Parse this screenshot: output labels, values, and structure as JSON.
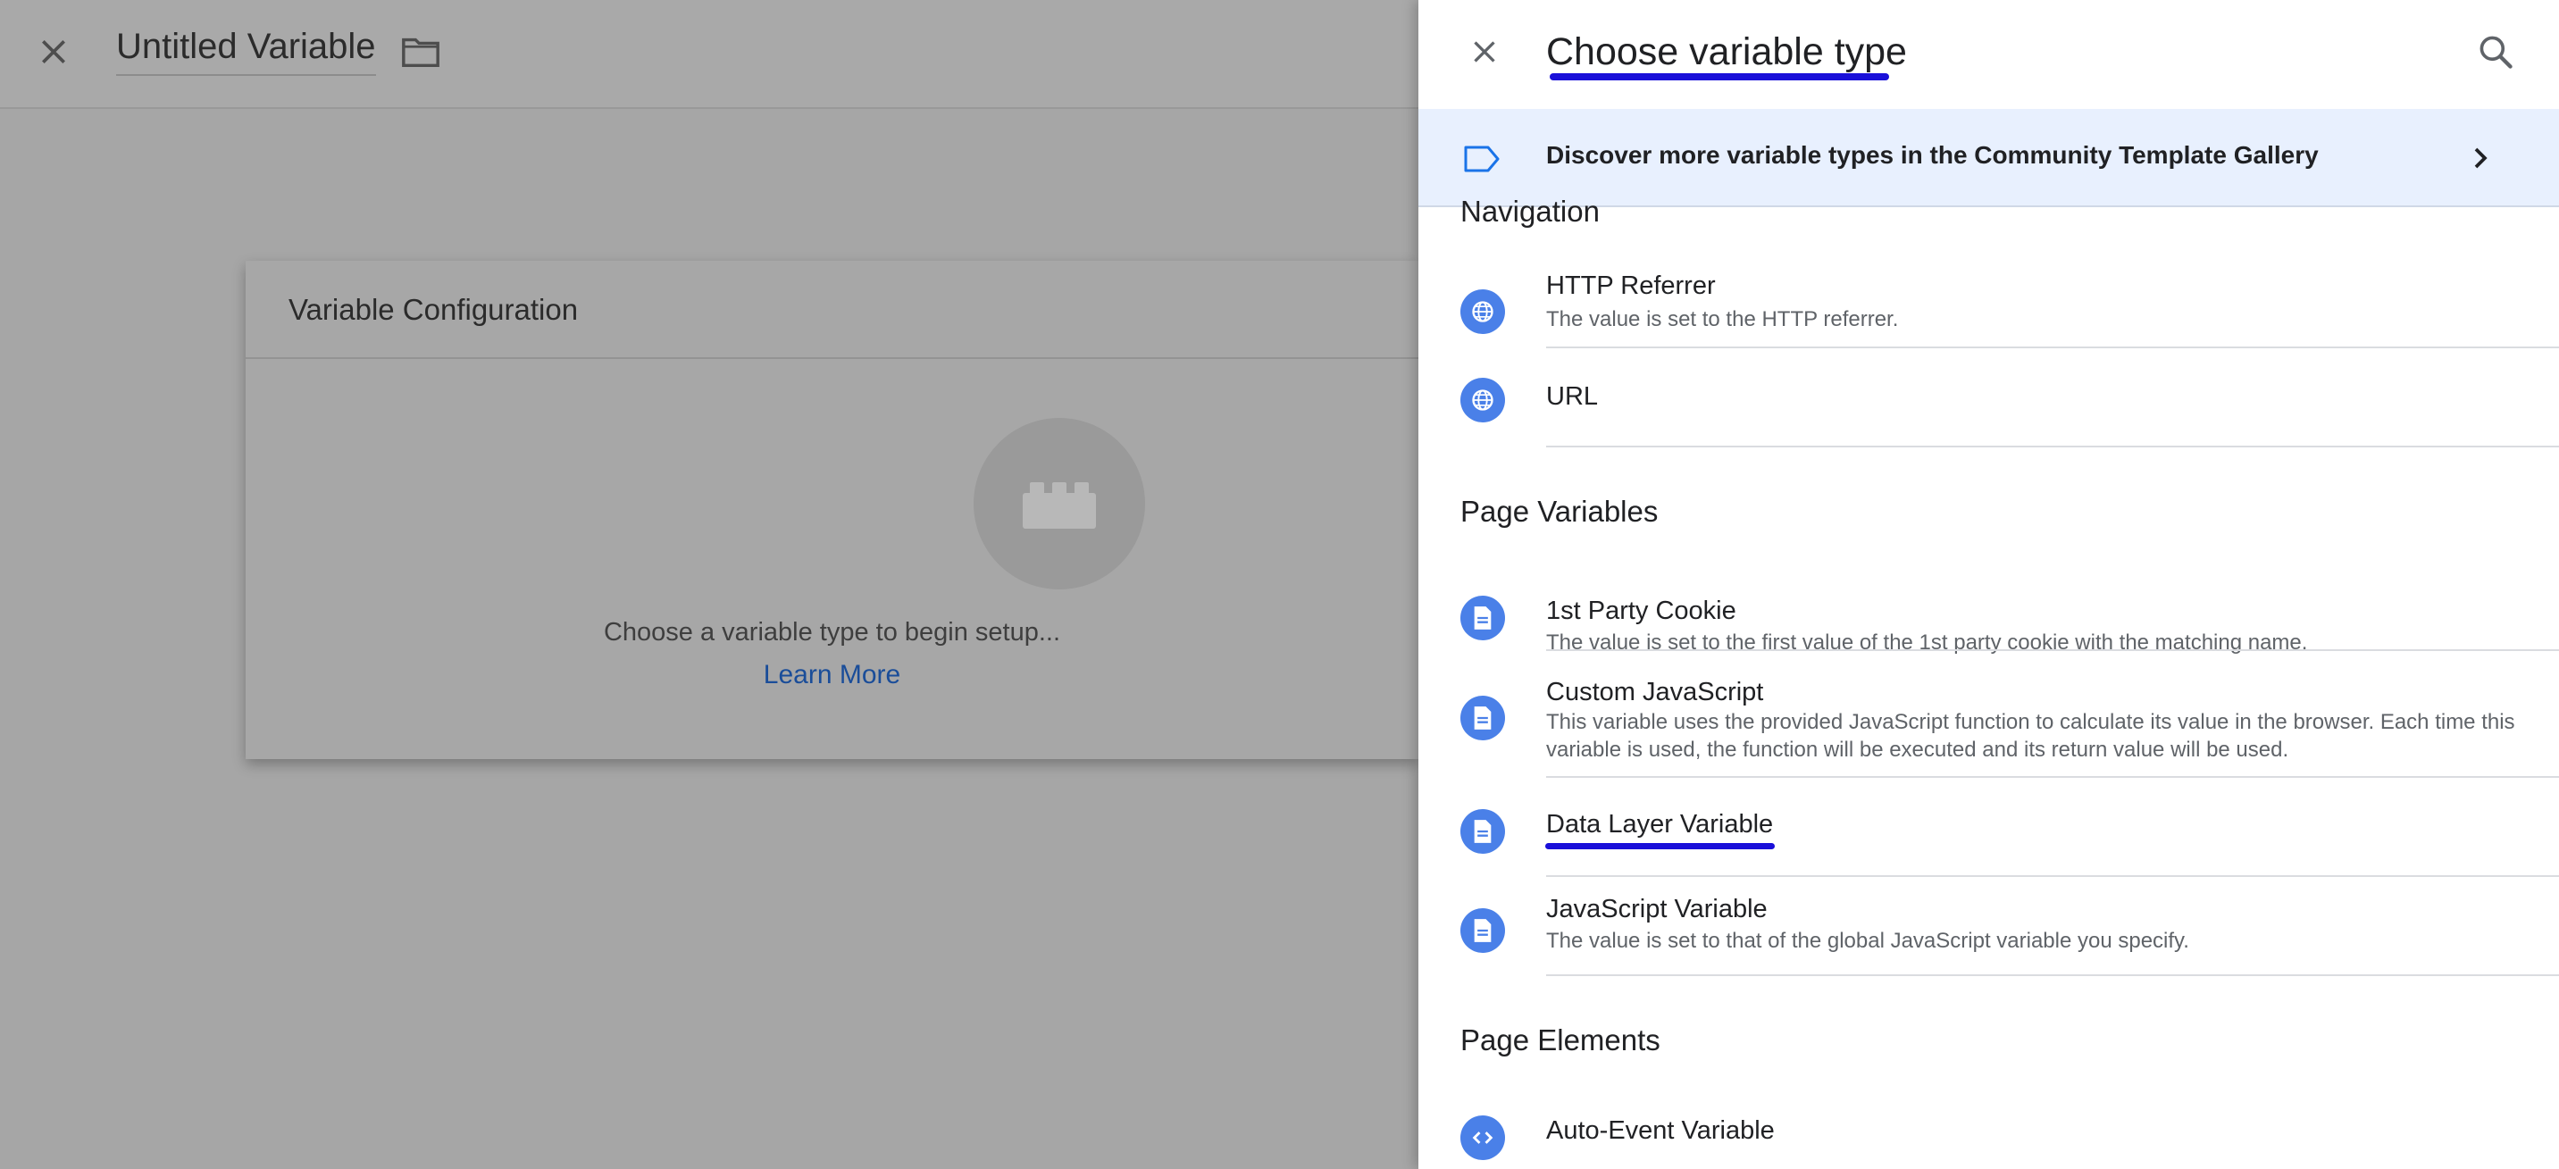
{
  "editor": {
    "title": "Untitled Variable",
    "card_title": "Variable Configuration",
    "placeholder_text": "Choose a variable type to begin setup...",
    "learn_more": "Learn More"
  },
  "drawer": {
    "title": "Choose variable type",
    "banner_text": "Discover more variable types in the Community Template Gallery"
  },
  "sections": {
    "navigation": "Navigation",
    "page_variables": "Page Variables",
    "page_elements": "Page Elements"
  },
  "items": {
    "http_referrer": {
      "title": "HTTP Referrer",
      "desc": "The value is set to the HTTP referrer."
    },
    "url": {
      "title": "URL"
    },
    "first_party_cookie": {
      "title": "1st Party Cookie",
      "desc": "The value is set to the first value of the 1st party cookie with the matching name."
    },
    "custom_javascript": {
      "title": "Custom JavaScript",
      "desc": "This variable uses the provided JavaScript function to calculate its value in the browser. Each time this variable is used, the function will be executed and its return value will be used."
    },
    "data_layer_variable": {
      "title": "Data Layer Variable"
    },
    "javascript_variable": {
      "title": "JavaScript Variable",
      "desc": "The value is set to that of the global JavaScript variable you specify."
    },
    "auto_event_variable": {
      "title": "Auto-Event Variable"
    }
  },
  "colors": {
    "accent": "#4a80e8",
    "annotation": "#1a10d9",
    "banner_bg": "#e8f0fe",
    "link": "#1a4d99"
  },
  "icons": {
    "close": "close-icon",
    "folder": "folder-icon",
    "search": "search-icon",
    "tag": "tag-icon",
    "chevron": "chevron-right-icon",
    "globe": "globe-icon",
    "document": "document-icon",
    "code": "code-icon",
    "lego": "lego-brick-icon"
  }
}
